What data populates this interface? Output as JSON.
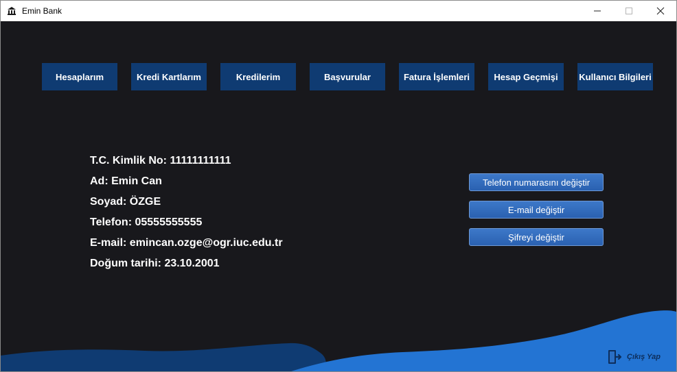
{
  "window": {
    "title": "Emin Bank"
  },
  "nav": {
    "items": [
      {
        "label": "Hesaplarım"
      },
      {
        "label": "Kredi Kartlarım"
      },
      {
        "label": "Kredilerim"
      },
      {
        "label": "Başvurular"
      },
      {
        "label": "Fatura İşlemleri"
      },
      {
        "label": "Hesap Geçmişi"
      },
      {
        "label": "Kullanıcı Bilgileri"
      }
    ]
  },
  "user_info": {
    "tc": "T.C. Kimlik No: 11111111111",
    "name": "Ad: Emin Can",
    "surname": "Soyad: ÖZGE",
    "phone": "Telefon: 05555555555",
    "email": "E-mail: emincan.ozge@ogr.iuc.edu.tr",
    "birth": "Doğum tarihi: 23.10.2001"
  },
  "actions": {
    "change_phone": "Telefon numarasını değiştir",
    "change_email": "E-mail değiştir",
    "change_password": "Şifreyi değiştir"
  },
  "logout": {
    "label": "Çıkış Yap",
    "icon": "logout-icon"
  },
  "colors": {
    "background": "#18181c",
    "nav_button": "#0f3b72",
    "action_button": "#2f66b5",
    "wave_dark": "#0f3b72",
    "wave_light": "#2374d3"
  }
}
